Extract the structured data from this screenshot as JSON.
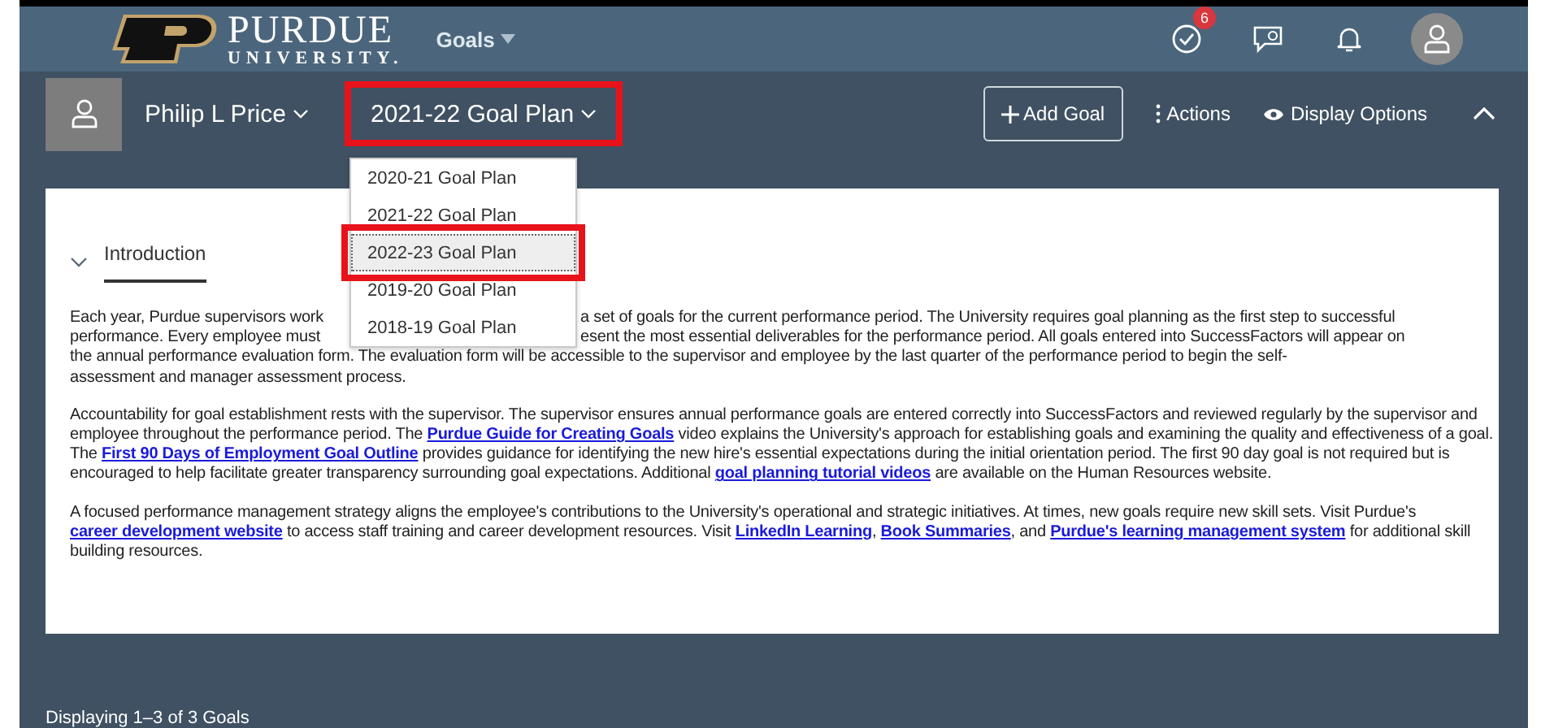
{
  "header": {
    "logo_name": "PURDUE",
    "logo_sub": "UNIVERSITY.",
    "module": "Goals",
    "badge": "6"
  },
  "toolbar": {
    "user": "Philip L Price",
    "plan": "2021-22 Goal Plan",
    "plan_highlighted": true,
    "add": "Add Goal",
    "actions": "Actions",
    "display": "Display Options"
  },
  "plan_menu": [
    {
      "label": "2020-21 Goal Plan",
      "selected": false,
      "highlighted": false
    },
    {
      "label": "2021-22 Goal Plan",
      "selected": false,
      "highlighted": false
    },
    {
      "label": "2022-23 Goal Plan",
      "selected": true,
      "highlighted": true
    },
    {
      "label": "2019-20 Goal Plan",
      "selected": false,
      "highlighted": false
    },
    {
      "label": "2018-19 Goal Plan",
      "selected": false,
      "highlighted": false
    }
  ],
  "section": {
    "title": "Introduction",
    "expanded": true
  },
  "intro_lines": [
    {
      "left": "Each year, Purdue supervisors work",
      "right": "a set of goals for the current performance period. The University requires goal planning as the first step to successful"
    },
    {
      "left": "performance. Every employee must",
      "right": "esent the most essential deliverables for the performance period. All goals entered into SuccessFactors will appear on"
    },
    {
      "left": "the annual performance evaluation form. The evaluation form will be accessible to the supervisor and employee by the last quarter of the performance period to begin the self-"
    },
    {
      "left": "assessment and manager assessment process."
    }
  ],
  "paragraphs": [
    [
      {
        "text": "Accountability for goal establishment rests with the supervisor. The supervisor ensures annual performance goals are entered correctly into SuccessFactors and reviewed regularly by the supervisor and employee throughout the performance period. The "
      },
      {
        "text": "Purdue Guide for Creating Goals",
        "link": true
      },
      {
        "text": " video explains the University's approach for establishing goals and examining the quality and effectiveness of a goal. The "
      },
      {
        "text": "First 90 Days of Employment Goal Outline",
        "link": true
      },
      {
        "text": " provides guidance for identifying the new hire's essential expectations during the initial orientation period.  The first 90 day goal is not required but is encouraged to help facilitate greater transparency surrounding goal expectations.  Additional "
      },
      {
        "text": "goal planning tutorial videos",
        "link": true
      },
      {
        "text": " are available on the Human Resources website."
      }
    ],
    [
      {
        "text": "A focused performance management strategy aligns the employee's contributions to the University's operational and strategic initiatives. At times, new goals require new skill sets. Visit Purdue's "
      },
      {
        "text": "career development website",
        "link": true
      },
      {
        "text": " to access staff training and career development resources. Visit "
      },
      {
        "text": "LinkedIn Learning",
        "link": true
      },
      {
        "text": ", "
      },
      {
        "text": "Book Summaries",
        "link": true
      },
      {
        "text": ", and "
      },
      {
        "text": "Purdue's learning management system",
        "link": true
      },
      {
        "text": " for additional skill building resources."
      }
    ]
  ],
  "footer": "Displaying 1–3 of 3 Goals"
}
